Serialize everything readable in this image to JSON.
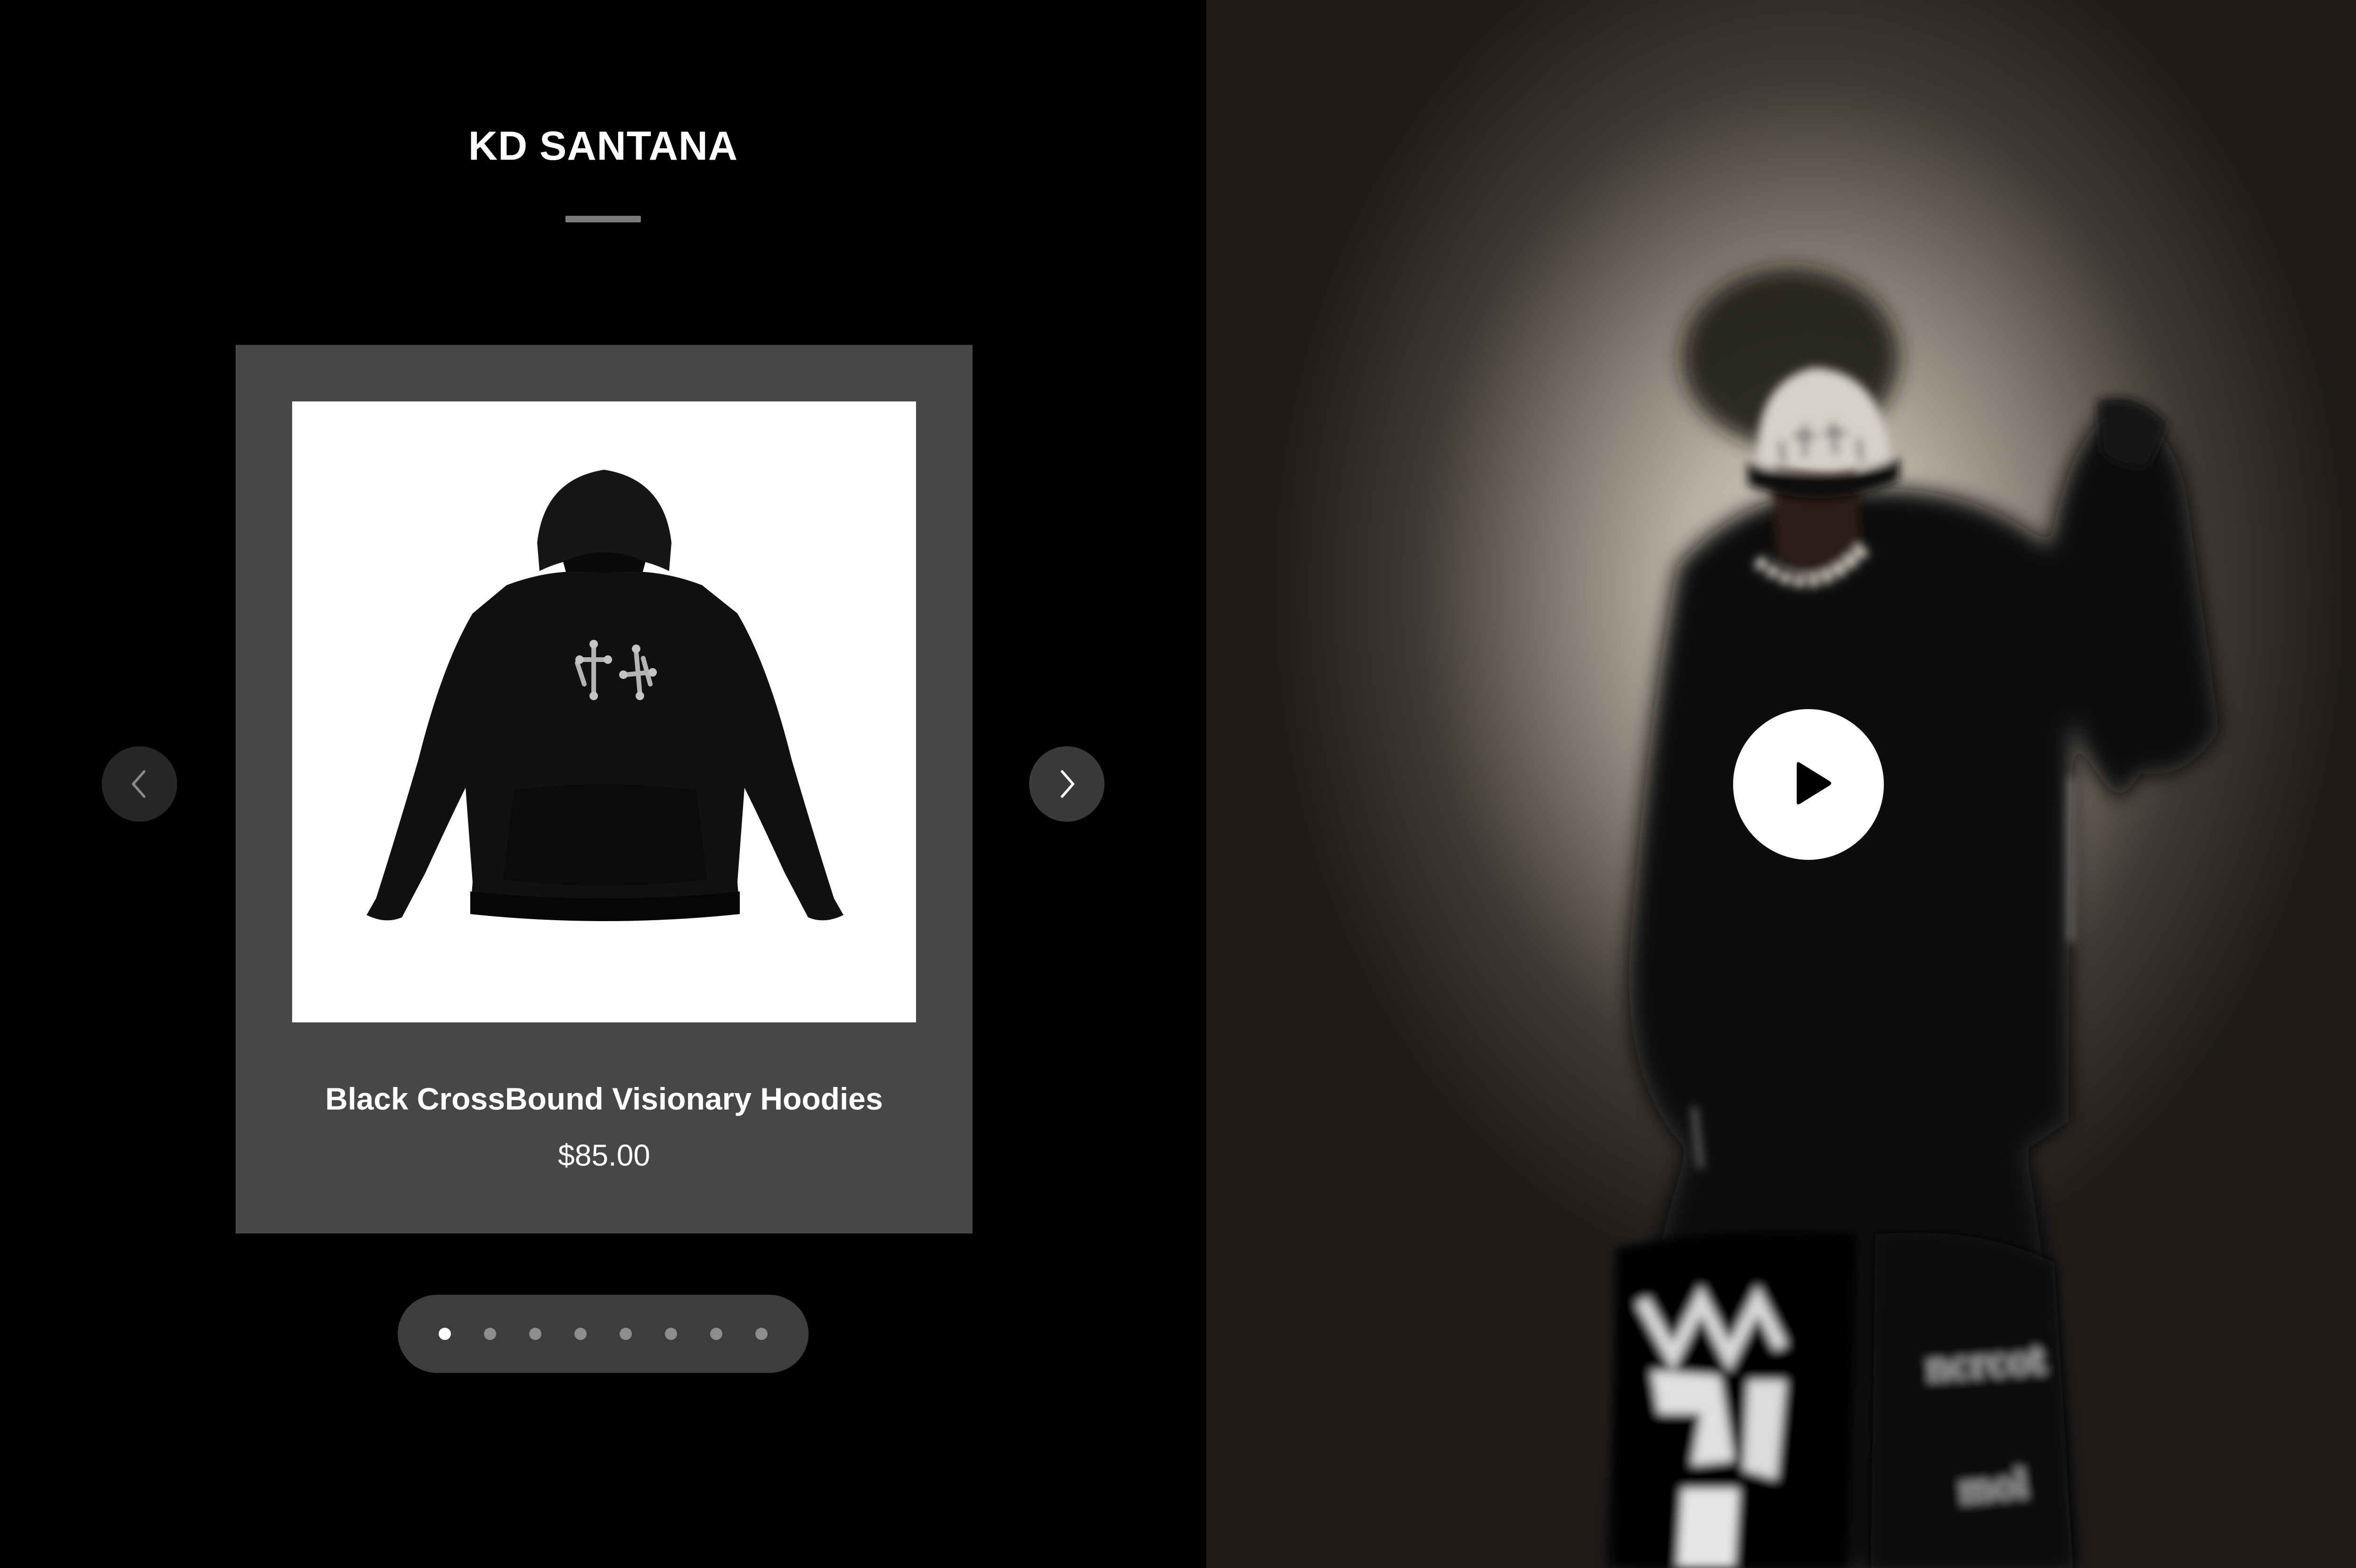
{
  "brand": {
    "title": "KD SANTANA"
  },
  "carousel": {
    "product": {
      "name": "Black CrossBound Visionary Hoodies",
      "price": "$85.00",
      "image_icon": "hoodie-product-image"
    },
    "prev_icon": "chevron-left-icon",
    "next_icon": "chevron-right-icon",
    "pager": {
      "total": 8,
      "active_index": 0
    }
  },
  "video": {
    "play_icon": "play-icon",
    "poster": "model-wearing-hoodie-photo"
  },
  "colors": {
    "page_background": "#000000",
    "card_background": "#474747",
    "pager_background": "#3d3d3d",
    "accent_white": "#ffffff"
  }
}
